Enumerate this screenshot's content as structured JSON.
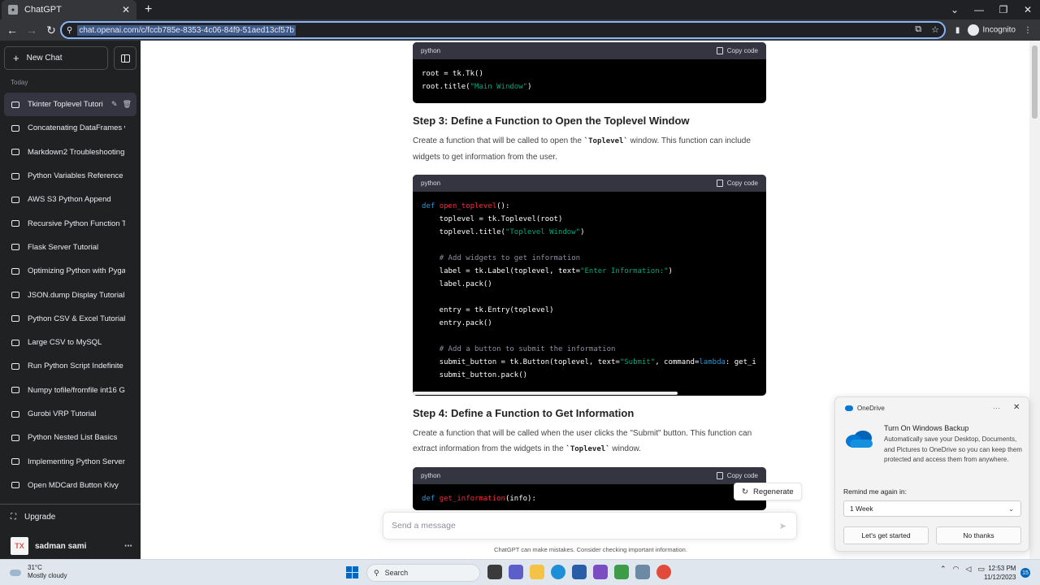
{
  "browser": {
    "tab_title": "ChatGPT",
    "url": "chat.openai.com/c/fccb785e-8353-4c06-84f9-51aed13cf57b",
    "profile": "Incognito"
  },
  "sidebar": {
    "new_chat": "New Chat",
    "section": "Today",
    "items": [
      {
        "label": "Tkinter Toplevel Tutori",
        "active": true
      },
      {
        "label": "Concatenating DataFrames v"
      },
      {
        "label": "Markdown2 Troubleshooting"
      },
      {
        "label": "Python Variables Reference"
      },
      {
        "label": "AWS S3 Python Append"
      },
      {
        "label": "Recursive Python Function T"
      },
      {
        "label": "Flask Server Tutorial"
      },
      {
        "label": "Optimizing Python with Pyga"
      },
      {
        "label": "JSON.dump Display Tutorial"
      },
      {
        "label": "Python CSV & Excel Tutorial"
      },
      {
        "label": "Large CSV to MySQL"
      },
      {
        "label": "Run Python Script Indefinite"
      },
      {
        "label": "Numpy tofile/fromfile int16 G"
      },
      {
        "label": "Gurobi VRP Tutorial"
      },
      {
        "label": "Python Nested List Basics"
      },
      {
        "label": "Implementing Python Server"
      },
      {
        "label": "Open MDCard Button Kivy"
      }
    ],
    "upgrade": "Upgrade",
    "user_initials": "TX",
    "user_name": "sadman sami"
  },
  "content": {
    "lang": "python",
    "copy_label": "Copy code",
    "step3_title": "Step 3: Define a Function to Open the Toplevel Window",
    "step3_text_a": "Create a function that will be called to open the ",
    "step3_code": "`Toplevel`",
    "step3_text_b": " window. This function can include widgets to get information from the user.",
    "step4_title": "Step 4: Define a Function to Get Information",
    "step4_text_a": "Create a function that will be called when the user clicks the \"Submit\" button. This function can extract information from the widgets in the ",
    "step4_code": "`Toplevel`",
    "step4_text_b": " window.",
    "regenerate": "Regenerate",
    "input_placeholder": "Send a message",
    "disclaimer": "ChatGPT can make mistakes. Consider checking important information."
  },
  "toast": {
    "app": "OneDrive",
    "title": "Turn On Windows Backup",
    "body": "Automatically save your Desktop, Documents, and Pictures to OneDrive so you can keep them protected and access them from anywhere.",
    "remind_label": "Remind me again in:",
    "remind_value": "1 Week",
    "primary": "Let's get started",
    "secondary": "No thanks"
  },
  "taskbar": {
    "temp": "31°C",
    "condition": "Mostly cloudy",
    "search": "Search",
    "time": "12:53 PM",
    "date": "11/12/2023",
    "notifications": "15"
  }
}
